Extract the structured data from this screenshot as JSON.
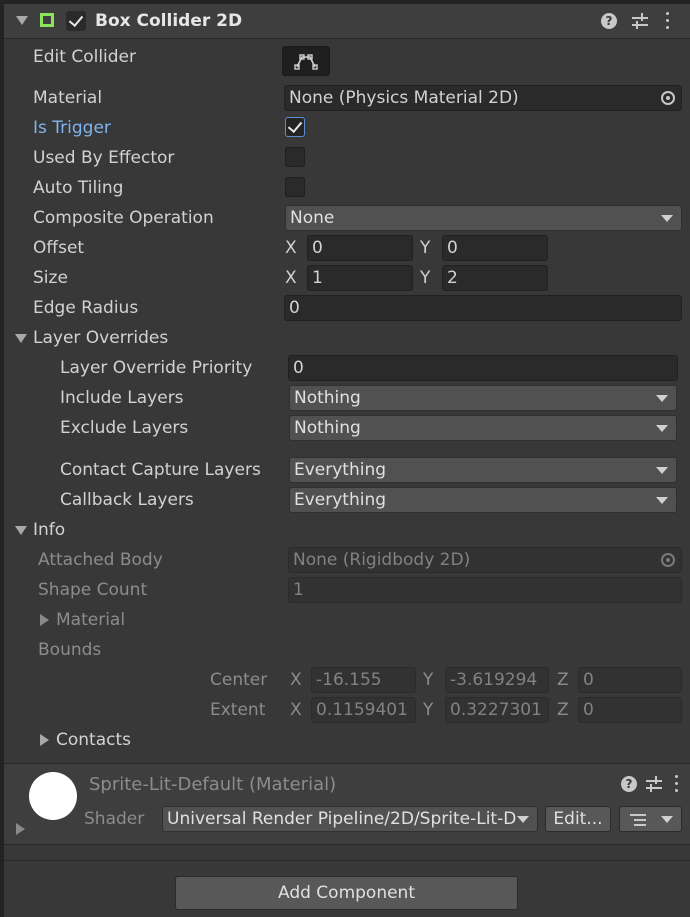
{
  "component": {
    "title": "Box Collider 2D",
    "help_icon": "help-icon",
    "presets_icon": "presets-sliders-icon",
    "menu_icon": "kebab-menu-icon"
  },
  "properties": {
    "edit_collider_label": "Edit Collider",
    "material_label": "Material",
    "material_value": "None (Physics Material 2D)",
    "is_trigger_label": "Is Trigger",
    "is_trigger_checked": true,
    "used_by_effector_label": "Used By Effector",
    "auto_tiling_label": "Auto Tiling",
    "composite_operation_label": "Composite Operation",
    "composite_operation_value": "None",
    "offset_label": "Offset",
    "offset_x": "0",
    "offset_y": "0",
    "size_label": "Size",
    "size_x": "1",
    "size_y": "2",
    "edge_radius_label": "Edge Radius",
    "edge_radius_value": "0",
    "axis_x": "X",
    "axis_y": "Y",
    "axis_z": "Z"
  },
  "layer_overrides": {
    "label": "Layer Overrides",
    "priority_label": "Layer Override Priority",
    "priority_value": "0",
    "include_label": "Include Layers",
    "include_value": "Nothing",
    "exclude_label": "Exclude Layers",
    "exclude_value": "Nothing",
    "contact_capture_label": "Contact Capture Layers",
    "contact_capture_value": "Everything",
    "callback_label": "Callback Layers",
    "callback_value": "Everything"
  },
  "info": {
    "label": "Info",
    "attached_body_label": "Attached Body",
    "attached_body_value": "None (Rigidbody 2D)",
    "shape_count_label": "Shape Count",
    "shape_count_value": "1",
    "material_label": "Material",
    "bounds_label": "Bounds",
    "center_label": "Center",
    "center_x": "-16.155",
    "center_y": "-3.619294",
    "center_z": "0",
    "extent_label": "Extent",
    "extent_x": "0.1159401",
    "extent_y": "0.3227301",
    "extent_z": "0",
    "contacts_label": "Contacts"
  },
  "material_section": {
    "name": "Sprite-Lit-Default (Material)",
    "shader_label": "Shader",
    "shader_value": "Universal Render Pipeline/2D/Sprite-Lit-D",
    "edit_label": "Edit..."
  },
  "footer": {
    "add_component_label": "Add Component"
  }
}
